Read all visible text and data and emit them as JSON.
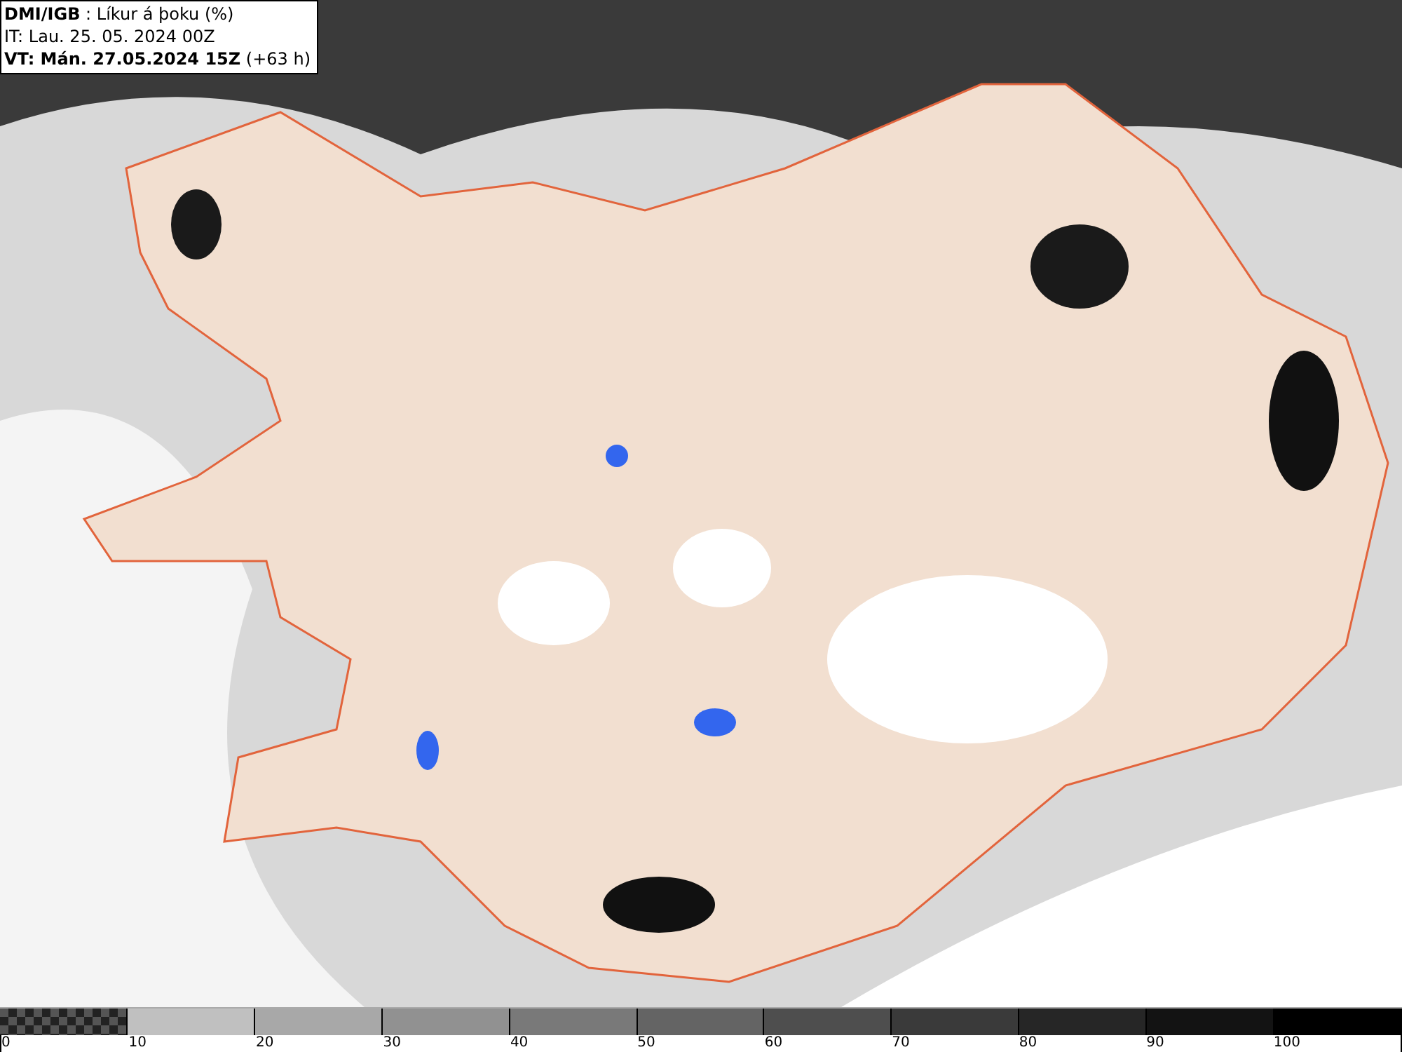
{
  "info": [
    "**DMI/IGB** : Líkur á þoku (%)",
    "IT: Lau. 25. 05. 2024 00Z",
    "**VT: Mán. 27.05.2024 15Z** (+63 h)"
  ],
  "legend": {
    "segments": [
      {
        "kind": "checker",
        "color": "#555555"
      },
      {
        "kind": "solid",
        "color": "#c0c0c0"
      },
      {
        "kind": "solid",
        "color": "#a8a8a8"
      },
      {
        "kind": "solid",
        "color": "#919191"
      },
      {
        "kind": "solid",
        "color": "#797979"
      },
      {
        "kind": "solid",
        "color": "#646464"
      },
      {
        "kind": "solid",
        "color": "#4e4e4e"
      },
      {
        "kind": "solid",
        "color": "#3a3a3a"
      },
      {
        "kind": "solid",
        "color": "#262626"
      },
      {
        "kind": "solid",
        "color": "#131313"
      },
      {
        "kind": "solid",
        "color": "#000000"
      }
    ],
    "ticks": [
      "0",
      "10",
      "20",
      "30",
      "40",
      "50",
      "60",
      "70",
      "80",
      "90",
      "100"
    ]
  }
}
